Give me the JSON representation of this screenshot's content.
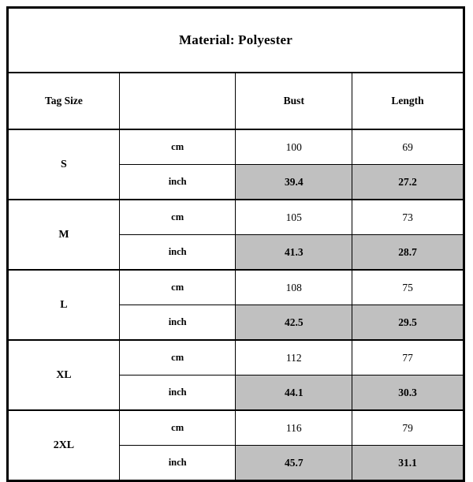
{
  "title": "Material: Polyester",
  "columns": {
    "size": "Tag Size",
    "unit": "",
    "bust": "Bust",
    "length": "Length"
  },
  "units": {
    "cm": "cm",
    "inch": "inch"
  },
  "colors": {
    "shaded_row": "#c0c0c0",
    "border": "#000000",
    "background": "#ffffff"
  },
  "rows": [
    {
      "size": "S",
      "cm": {
        "bust": "100",
        "length": "69"
      },
      "inch": {
        "bust": "39.4",
        "length": "27.2"
      }
    },
    {
      "size": "M",
      "cm": {
        "bust": "105",
        "length": "73"
      },
      "inch": {
        "bust": "41.3",
        "length": "28.7"
      }
    },
    {
      "size": "L",
      "cm": {
        "bust": "108",
        "length": "75"
      },
      "inch": {
        "bust": "42.5",
        "length": "29.5"
      }
    },
    {
      "size": "XL",
      "cm": {
        "bust": "112",
        "length": "77"
      },
      "inch": {
        "bust": "44.1",
        "length": "30.3"
      }
    },
    {
      "size": "2XL",
      "cm": {
        "bust": "116",
        "length": "79"
      },
      "inch": {
        "bust": "45.7",
        "length": "31.1"
      }
    }
  ]
}
